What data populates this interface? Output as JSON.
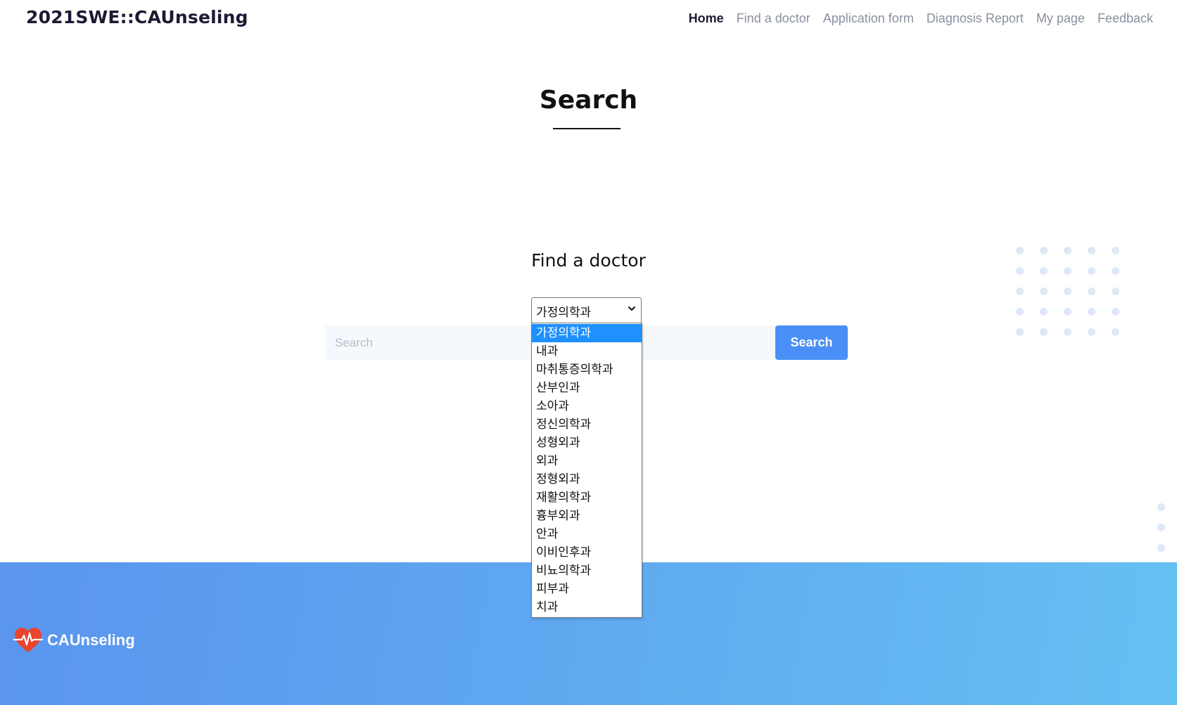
{
  "header": {
    "brand": "2021SWE::CAUnseling",
    "nav": [
      {
        "label": "Home",
        "active": true
      },
      {
        "label": "Find a doctor",
        "active": false
      },
      {
        "label": "Application form",
        "active": false
      },
      {
        "label": "Diagnosis Report",
        "active": false
      },
      {
        "label": "My page",
        "active": false
      },
      {
        "label": "Feedback",
        "active": false
      }
    ]
  },
  "page": {
    "title": "Search"
  },
  "find": {
    "title": "Find a doctor",
    "selected_department": "가정의학과",
    "search_placeholder": "Search",
    "search_button": "Search",
    "options": [
      "가정의학과",
      "내과",
      "마취통증의학과",
      "산부인과",
      "소아과",
      "정신의학과",
      "성형외과",
      "외과",
      "정형외과",
      "재활의학과",
      "흉부외과",
      "안과",
      "이비인후과",
      "비뇨의학과",
      "피부과",
      "치과"
    ]
  },
  "footer": {
    "brand": "CAUnseling"
  },
  "colors": {
    "accent": "#4a8ff5",
    "selected_option": "#1e90ff",
    "footer_gradient_start": "#5a95ee",
    "footer_gradient_end": "#66c1f3"
  }
}
